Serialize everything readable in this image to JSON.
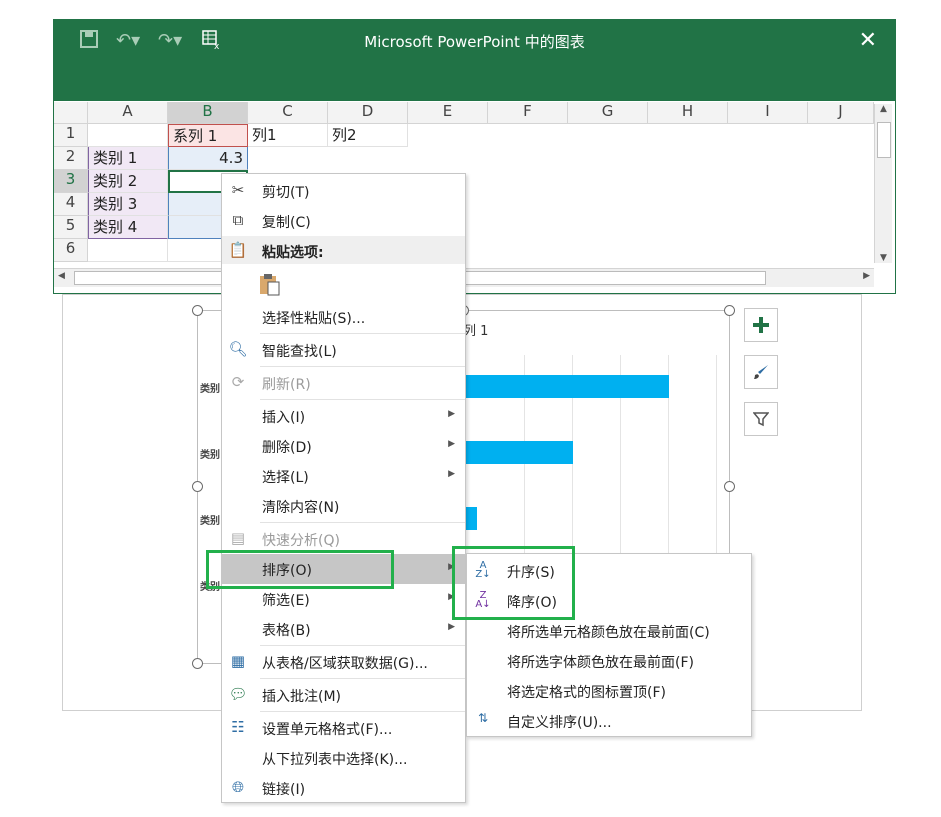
{
  "excel_window": {
    "title": "Microsoft PowerPoint 中的图表",
    "close": "✕",
    "columns": [
      "A",
      "B",
      "C",
      "D",
      "E",
      "F",
      "G",
      "H",
      "I",
      "J"
    ],
    "rows": [
      "1",
      "2",
      "3",
      "4",
      "5",
      "6"
    ],
    "cells": {
      "B1": "系列 1",
      "C1": "列1",
      "D1": "列2",
      "A2": "类别 1",
      "B2": "4.3",
      "A3": "类别 2",
      "A4": "类别 3",
      "A5": "类别 4"
    }
  },
  "chart": {
    "title_fragment": "列 1",
    "category_label": "类别",
    "bar_color": "#00b0f0"
  },
  "context_menu": {
    "items": [
      {
        "label": "剪切(T)",
        "icon": "scissors-icon"
      },
      {
        "label": "复制(C)",
        "icon": "copy-icon"
      },
      {
        "label": "粘贴选项:",
        "icon": "paste-icon"
      },
      {
        "label": "选择性粘贴(S)..."
      },
      {
        "label": "智能查找(L)",
        "icon": "search-icon"
      },
      {
        "label": "刷新(R)",
        "icon": "refresh-icon"
      },
      {
        "label": "插入(I)"
      },
      {
        "label": "删除(D)"
      },
      {
        "label": "选择(L)"
      },
      {
        "label": "清除内容(N)"
      },
      {
        "label": "快速分析(Q)",
        "icon": "quick-analysis-icon"
      },
      {
        "label": "排序(O)"
      },
      {
        "label": "筛选(E)"
      },
      {
        "label": "表格(B)"
      },
      {
        "label": "从表格/区域获取数据(G)...",
        "icon": "table-icon"
      },
      {
        "label": "插入批注(M)",
        "icon": "comment-icon"
      },
      {
        "label": "设置单元格格式(F)...",
        "icon": "format-cells-icon"
      },
      {
        "label": "从下拉列表中选择(K)..."
      },
      {
        "label": "链接(I)",
        "icon": "link-icon"
      }
    ]
  },
  "sort_submenu": {
    "items": [
      {
        "label": "升序(S)",
        "icon": "sort-ascending-icon"
      },
      {
        "label": "降序(O)",
        "icon": "sort-descending-icon"
      },
      {
        "label": "将所选单元格颜色放在最前面(C)"
      },
      {
        "label": "将所选字体颜色放在最前面(F)"
      },
      {
        "label": "将选定格式的图标置顶(F)"
      },
      {
        "label": "自定义排序(U)...",
        "icon": "custom-sort-icon"
      }
    ]
  },
  "accent_color": "#217346",
  "highlight_color": "#22b04b"
}
